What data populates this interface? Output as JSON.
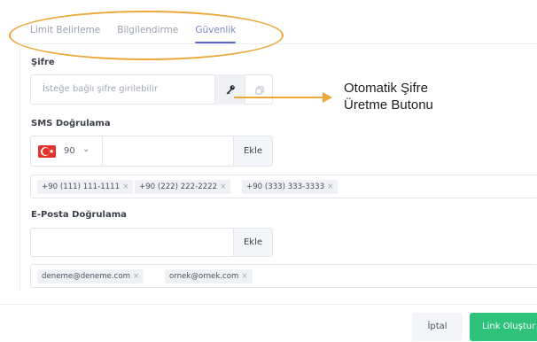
{
  "tabs": [
    {
      "label": "Limit Belirleme",
      "active": false
    },
    {
      "label": "Bilgilendirme",
      "active": false
    },
    {
      "label": "Güvenlik",
      "active": true
    }
  ],
  "password": {
    "label": "Şifre",
    "placeholder": "İsteğe bağlı şifre girilebilir",
    "generate_icon": "key-icon",
    "copy_icon": "copy-icon"
  },
  "annotation": {
    "line1": "Otomatik Şifre",
    "line2": "Üretme Butonu",
    "color": "#eba83a"
  },
  "sms": {
    "label": "SMS Doğrulama",
    "country_code": "90",
    "flag": "turkey-flag",
    "phone_value": "",
    "add_label": "Ekle",
    "chips": [
      "+90 (111) 111-1111",
      "+90 (222) 222-2222",
      "+90 (333) 333-3333"
    ]
  },
  "email": {
    "label": "E-Posta Doğrulama",
    "value": "",
    "add_label": "Ekle",
    "chips": [
      "deneme@deneme.com",
      "ornek@ornek.com"
    ]
  },
  "footer": {
    "cancel_label": "İptal",
    "create_label": "Link Oluştur",
    "create_color": "#2fc27b"
  },
  "colors": {
    "accent": "#5a67c8",
    "highlight": "#eba83a"
  }
}
